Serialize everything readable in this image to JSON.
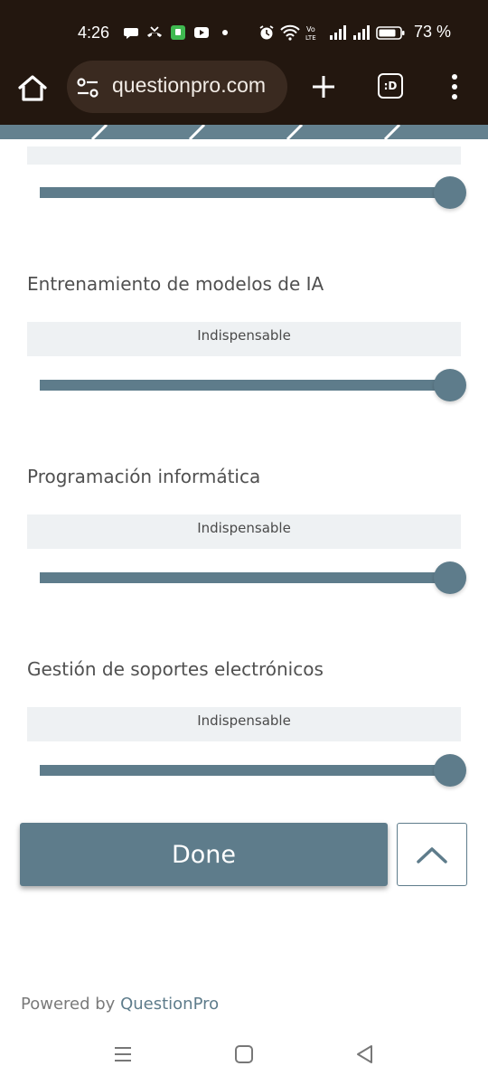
{
  "status_bar": {
    "time": "4:26",
    "battery_pct": "73 %",
    "icons": [
      "chat-bubble-icon",
      "missed-call-icon",
      "app-badge-icon",
      "youtube-icon",
      "notification-dot",
      "alarm-icon",
      "wifi-icon",
      "volte-icon",
      "signal-icon",
      "signal-icon",
      "battery-icon"
    ]
  },
  "browser": {
    "url": "questionpro.com",
    "tab_label": ":D"
  },
  "questions": [
    {
      "title": "",
      "value_label": "",
      "level": 1.0
    },
    {
      "title": "Entrenamiento de modelos de IA",
      "value_label": "Indispensable",
      "level": 1.0
    },
    {
      "title": "Programación informática",
      "value_label": "Indispensable",
      "level": 1.0
    },
    {
      "title": "Gestión de soportes electrónicos",
      "value_label": "Indispensable",
      "level": 1.0
    }
  ],
  "actions": {
    "done_label": "Done"
  },
  "footer": {
    "powered_prefix": "Powered by",
    "brand": "QuestionPro"
  },
  "colors": {
    "accent": "#5e7c8b",
    "statusbar_bg": "#23170f",
    "label_bg": "#eef1f3"
  }
}
